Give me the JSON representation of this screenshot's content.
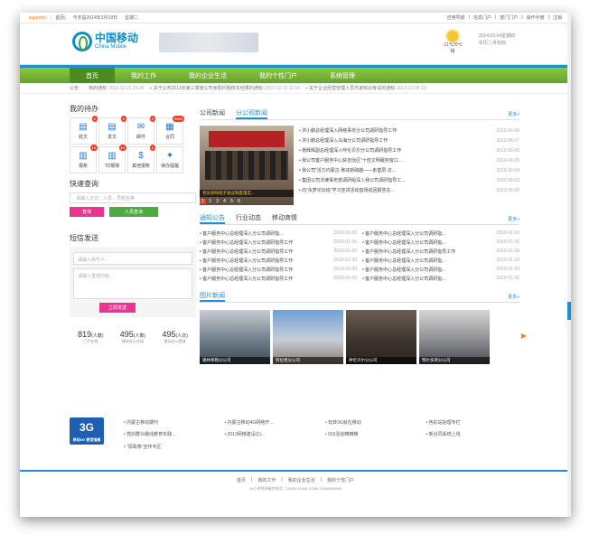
{
  "topbar": {
    "user": "wgadmin",
    "home": "首页|",
    "date_text": "今天是2014年3月18日",
    "weekday": "星期二",
    "right_links": [
      "应用导航",
      "信息门户",
      "部门门户",
      "操作手册",
      "注销"
    ]
  },
  "header": {
    "logo_cn": "中国移动",
    "logo_en": "China Mobile",
    "weather_temp": "-11℃/0℃",
    "weather_desc": "晴",
    "date_line1": "2014.03.04星期四",
    "date_line2": "农历二月初四"
  },
  "nav": {
    "items": [
      "首页",
      "我的工作",
      "我的企业生活",
      "我的个性门户",
      "系统管理"
    ]
  },
  "notice": {
    "label": "公告：",
    "items": [
      {
        "t": "我的通知",
        "d": "2013-12-31 15:26"
      },
      {
        "t": "关于公布2013年第三季度公司考勤问题核实结果的通知",
        "d": "2013-12-23 11:18"
      },
      {
        "t": "关于企业经营管理人员杰家知识考试的通知",
        "d": "2013-12-06 15:"
      }
    ]
  },
  "todo": {
    "title": "我的待办",
    "items": [
      {
        "label": "收文",
        "badge": "0",
        "icon": "▤"
      },
      {
        "label": "发文",
        "badge": "0",
        "icon": "▤"
      },
      {
        "label": "邮件",
        "badge": "0",
        "icon": "✉"
      },
      {
        "label": "合同",
        "badge": "9999",
        "icon": "▦"
      },
      {
        "label": "报账",
        "badge": "10",
        "icon": "▥"
      },
      {
        "label": "TD报账",
        "badge": "10",
        "icon": "▥"
      },
      {
        "label": "其他报账",
        "badge": "0",
        "icon": "$"
      },
      {
        "label": "待办提醒",
        "badge": "",
        "icon": "✦"
      }
    ]
  },
  "quick": {
    "title": "快速查询",
    "placeholder": "请输入分文、人员、员姓名等",
    "query": "查询",
    "people": "人员查询"
  },
  "sms": {
    "title": "短信发送",
    "to_placeholder": "请输入收件人：",
    "body_placeholder": "请输入发送内容...",
    "send": "立即发送"
  },
  "stats": [
    {
      "n": "819",
      "unit": "(人数)",
      "l": "门户在线"
    },
    {
      "n": "495",
      "unit": "(人数)",
      "l": "移动办公在线"
    },
    {
      "n": "495",
      "unit": "(人次)",
      "l": "移动办公登录"
    }
  ],
  "news": {
    "tabs": [
      "公司新闻",
      "分公司新闻"
    ],
    "more": "更多»",
    "photo_caption": "党员领导班子会议制度落实...",
    "pager": [
      "1",
      "2",
      "3",
      "4",
      "5",
      "6"
    ],
    "items": [
      {
        "t": "洪小鹏总经理深入网络事务分公司调研指导工作",
        "d": "2013-06-08"
      },
      {
        "t": "洪小鹏总经理深入乌海分公司调研指导工作",
        "d": "2013-06-07"
      },
      {
        "t": "杨辉辉副总经理深入呼伦贝尔分公司调研指导工作",
        "d": "2013-06-06"
      },
      {
        "t": "我公司客户服务中心获自治区“十佳文明服务窗口...",
        "d": "2013-06-05"
      },
      {
        "t": "我公司“活力内蒙古 移动新跨越——走基层 访...",
        "d": "2013-06-04"
      },
      {
        "t": "集团公司法律事务部调研组深入我公司调研指导工...",
        "d": "2013-06-03"
      },
      {
        "t": "向“永梦论坛班”学习宣讲活动首场巡回报告在...",
        "d": "2013-06-02"
      }
    ]
  },
  "notice_tabs": {
    "tabs": [
      "通知公告",
      "行业动态",
      "移动商情"
    ],
    "more": "更多»",
    "left": [
      {
        "t": "客户服务中心总经理深入分公司调研指...",
        "d": "2010-01-30"
      },
      {
        "t": "客户服务中心总经理深入分公司调研指导工作",
        "d": "2010-01-30"
      },
      {
        "t": "客户服务中心总经理深入分公司调研指导工作",
        "d": "2010-01-30"
      },
      {
        "t": "客户服务中心总经理深入分公司调研指导工作",
        "d": "2010-01-30"
      },
      {
        "t": "客户服务中心总经理深入分公司调研指导工作",
        "d": "2010-01-30"
      },
      {
        "t": "客户服务中心总经理深入分公司调研指导工作",
        "d": "2010-01-30"
      }
    ],
    "right": [
      {
        "t": "客户服务中心总经理深入分公司调研指...",
        "d": "2010-01-30"
      },
      {
        "t": "客户服务中心总经理深入分公司调研指...",
        "d": "2010-01-30"
      },
      {
        "t": "客户服务中心总经理深入分公司调研指导工作",
        "d": "2010-01-30"
      },
      {
        "t": "客户服务中心总经理深入分公司调研指...",
        "d": "2010-01-30"
      },
      {
        "t": "客户服务中心总经理深入分公司调研指...",
        "d": "2010-01-30"
      },
      {
        "t": "客户服务中心总经理深入分公司调研指...",
        "d": "2010-01-30"
      }
    ]
  },
  "pictures": {
    "title": "图片新闻",
    "more": "更多»",
    "items": [
      {
        "cap": "锡林郭勒分公司",
        "bg": "#6f7f8c"
      },
      {
        "cap": "阿拉善分公司",
        "bg": "#7a9bc4"
      },
      {
        "cap": "呼伦贝尔分公司",
        "bg": "#5b4f45"
      },
      {
        "cap": "鄂尔多斯分公司",
        "bg": "#8d8e94"
      }
    ]
  },
  "links": {
    "logo": "3G",
    "logo_sub": "移动3G 使用指南",
    "items": [
      "内蒙古移动期刊",
      "内蒙古移动4G网络开...",
      "玩转3G就在移动",
      "色彩站始理专栏",
      "党的群众路线教育实践...",
      "2013网络建设(1)...",
      "916活动精精精",
      "新合同系统上线",
      "“鄂政哆”宣传专区",
      "",
      "",
      ""
    ]
  },
  "footer": {
    "links": [
      "首页",
      "我的工作",
      "我的企业生活",
      "我的个性门户"
    ],
    "copy": "24小时热线服务电话：10086 10086 10086 13388866688"
  }
}
